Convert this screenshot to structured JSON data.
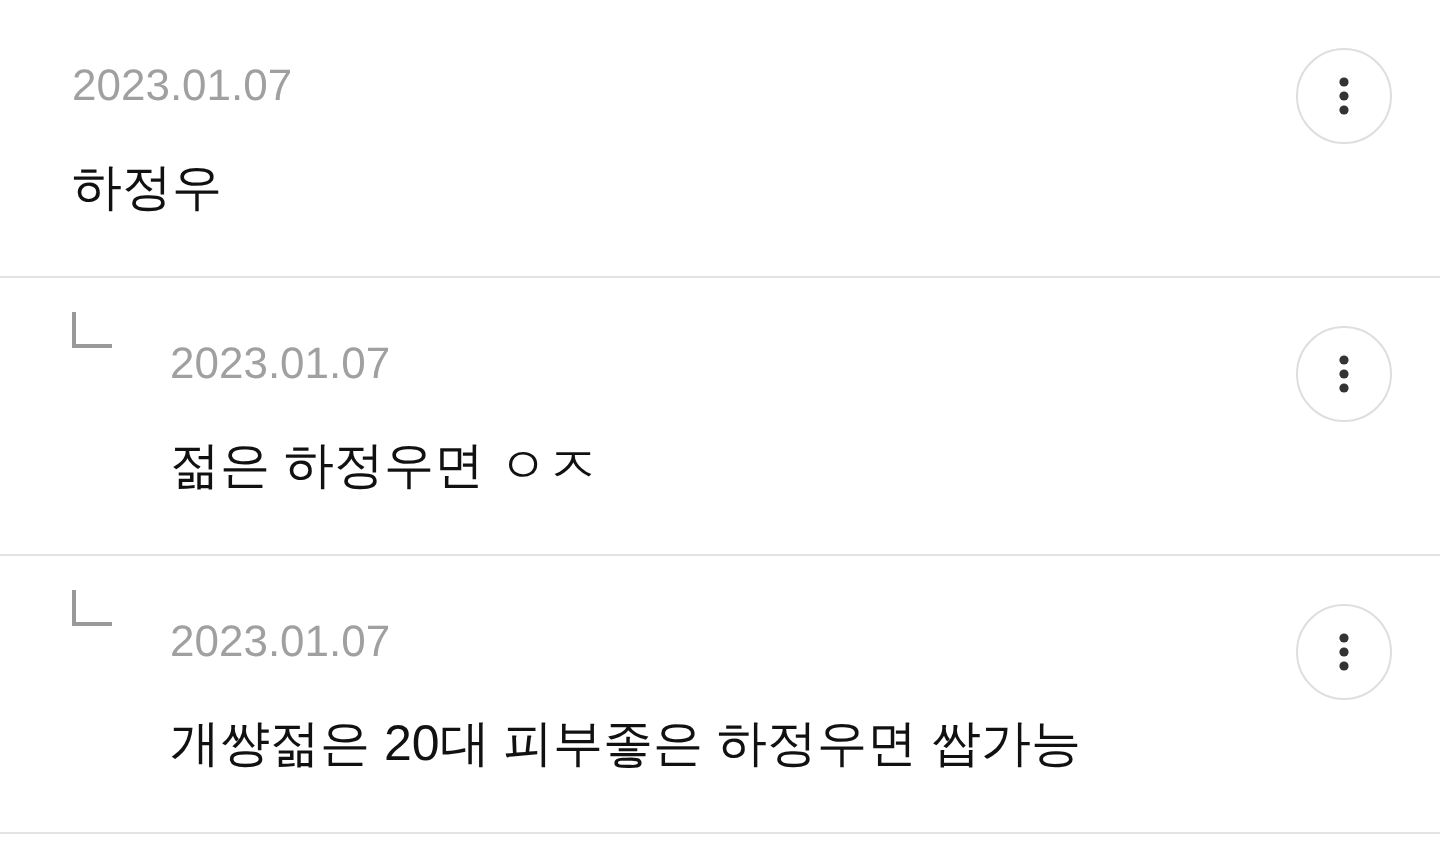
{
  "comments": [
    {
      "kind": "comment",
      "date": "2023.01.07",
      "text": "하정우"
    },
    {
      "kind": "reply",
      "date": "2023.01.07",
      "text": "젊은 하정우면 ㅇㅈ"
    },
    {
      "kind": "reply",
      "date": "2023.01.07",
      "text": "개썅젊은 20대 피부좋은 하정우면 쌉가능"
    }
  ]
}
